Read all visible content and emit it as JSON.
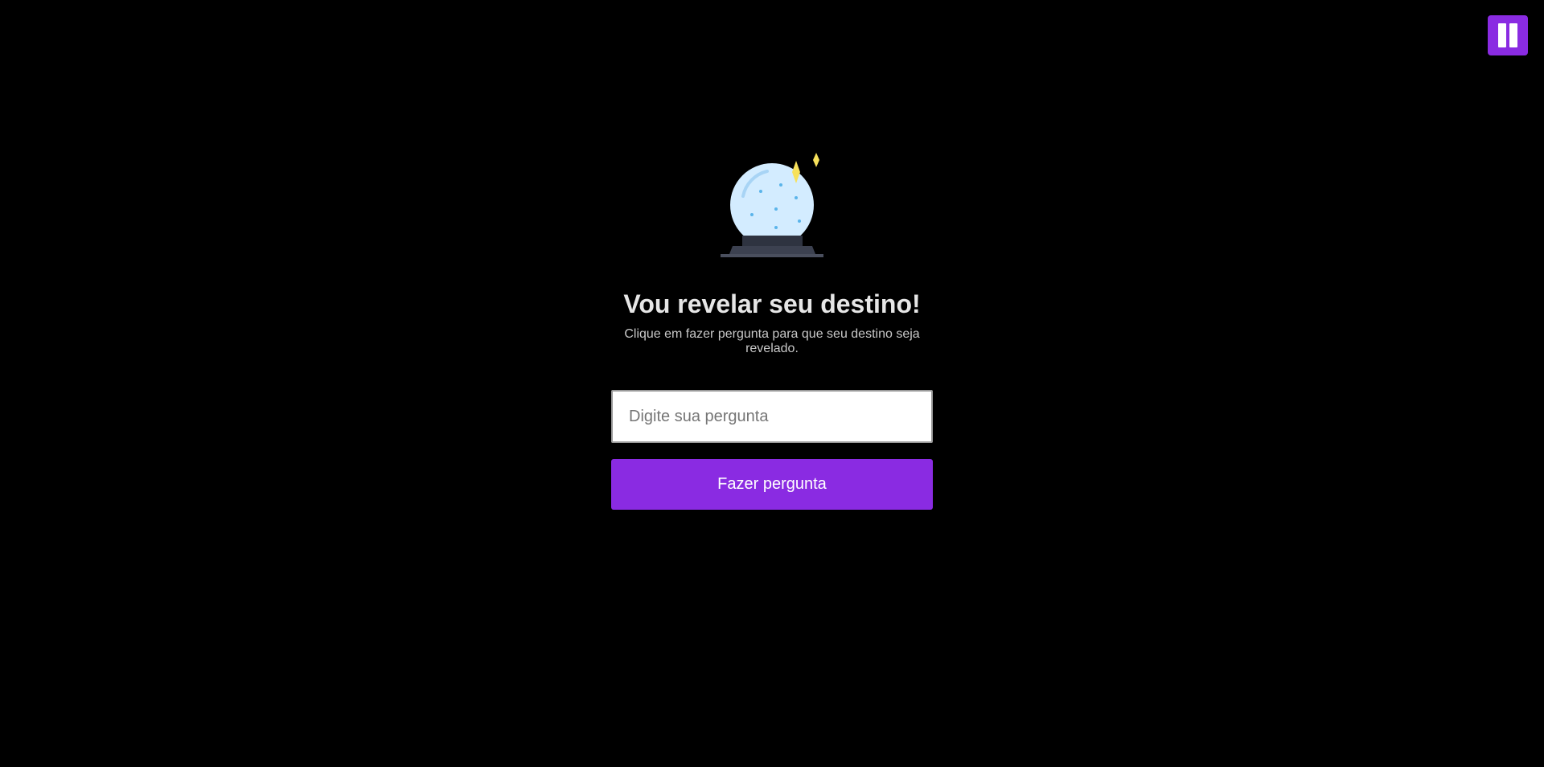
{
  "controls": {
    "pause_icon": "pause-icon",
    "accent_color": "#8a2be2"
  },
  "hero": {
    "image_icon": "crystal-ball-icon",
    "title": "Vou revelar seu destino!",
    "subtitle": "Clique em fazer pergunta para que seu destino seja revelado."
  },
  "form": {
    "question_placeholder": "Digite sua pergunta",
    "question_value": "",
    "ask_label": "Fazer pergunta"
  }
}
